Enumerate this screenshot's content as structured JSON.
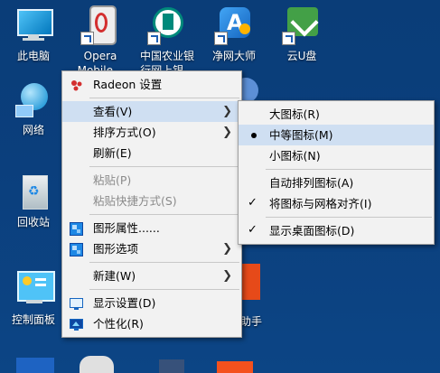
{
  "desktop_icons": [
    {
      "label_lines": [
        "此电脑"
      ],
      "icon": "this-pc-icon"
    },
    {
      "label_lines": [
        "Opera",
        "Mobile..."
      ],
      "icon": "opera-mobile-icon"
    },
    {
      "label_lines": [
        "中国农业银",
        "行网上银..."
      ],
      "icon": "abc-bank-icon"
    },
    {
      "label_lines": [
        "净网大师"
      ],
      "icon": "adsafe-icon"
    },
    {
      "label_lines": [
        "云U盘"
      ],
      "icon": "cloud-usb-icon"
    },
    {
      "label_lines": [
        "网络"
      ],
      "icon": "network-icon"
    },
    {
      "label_lines": [
        "回收站"
      ],
      "icon": "recycle-bin-icon"
    },
    {
      "label_lines": [
        "控制面板"
      ],
      "icon": "control-panel-icon"
    },
    {
      "label_lines": [
        "助手"
      ],
      "icon": "assistant-icon"
    }
  ],
  "context_menu": {
    "radeon": "Radeon 设置",
    "view": "查看(V)",
    "sort": "排序方式(O)",
    "refresh": "刷新(E)",
    "paste": "粘贴(P)",
    "paste_shortcut": "粘贴快捷方式(S)",
    "graphics_props": "图形属性......",
    "graphics_options": "图形选项",
    "new": "新建(W)",
    "display": "显示设置(D)",
    "personalize": "个性化(R)"
  },
  "view_submenu": {
    "large": "大图标(R)",
    "medium": "中等图标(M)",
    "small": "小图标(N)",
    "auto_arrange": "自动排列图标(A)",
    "align_grid": "将图标与网格对齐(I)",
    "show_icons": "显示桌面图标(D)",
    "selected": "medium"
  },
  "colors": {
    "desktop_bg": "#0b3f7d",
    "menu_bg": "#f2f2f2",
    "highlight": "#cfdff2"
  }
}
